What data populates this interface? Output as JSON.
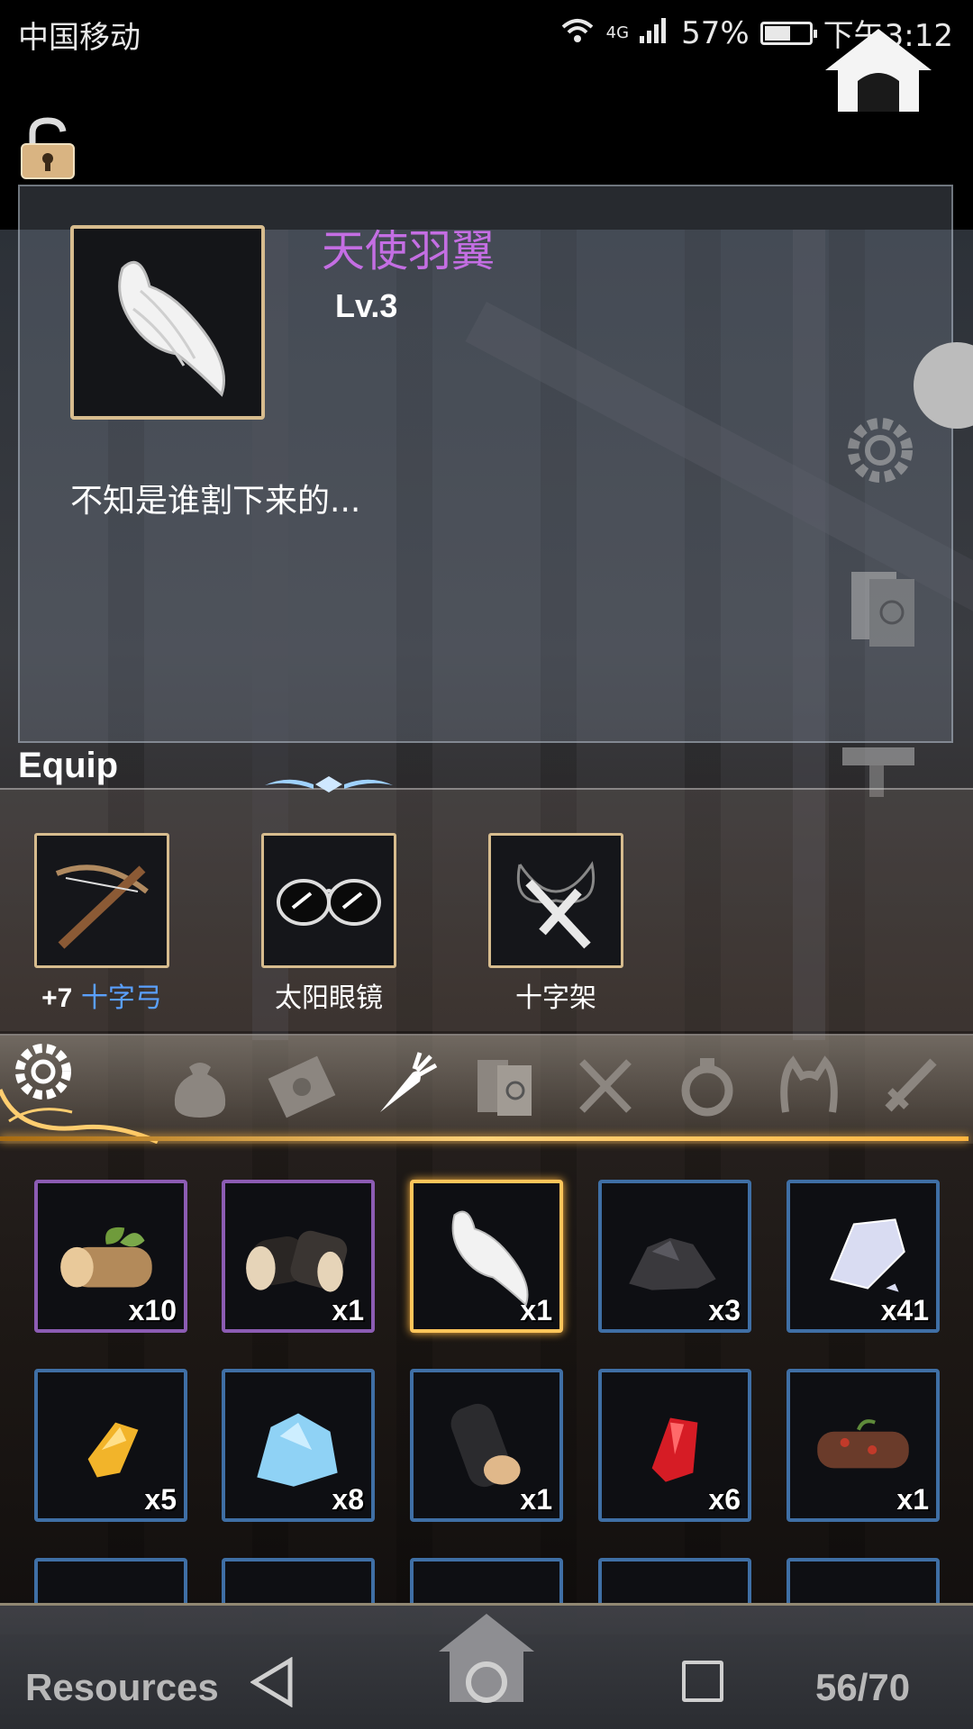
{
  "status_bar": {
    "carrier": "中国移动",
    "network": "4G",
    "battery": "57%",
    "time": "下午3:12"
  },
  "detail": {
    "name": "天使羽翼",
    "level": "Lv.3",
    "description": "不知是谁割下来的..."
  },
  "equip": {
    "title": "Equip",
    "slots": [
      {
        "plus": "+7",
        "name": "十字弓",
        "icon": "crossbow-icon"
      },
      {
        "plus": "",
        "name": "太阳眼镜",
        "icon": "sunglasses-icon"
      },
      {
        "plus": "",
        "name": "十字架",
        "icon": "cross-necklace-icon"
      }
    ]
  },
  "categories": [
    "bag-icon",
    "envelope-icon",
    "carrot-icon",
    "books-icon",
    "utensils-icon",
    "ring-icon",
    "headband-icon",
    "sword-icon"
  ],
  "inventory": [
    {
      "icon": "leafy-log-icon",
      "count": "x10",
      "rarity": "purple"
    },
    {
      "icon": "dark-logs-icon",
      "count": "x1",
      "rarity": "purple"
    },
    {
      "icon": "angel-wing-icon",
      "count": "x1",
      "rarity": "gold"
    },
    {
      "icon": "coal-icon",
      "count": "x3",
      "rarity": "blue"
    },
    {
      "icon": "crystal-plate-icon",
      "count": "x41",
      "rarity": "blue"
    },
    {
      "icon": "amber-gem-icon",
      "count": "x5",
      "rarity": "blue"
    },
    {
      "icon": "ice-crystal-icon",
      "count": "x8",
      "rarity": "blue"
    },
    {
      "icon": "charred-log-icon",
      "count": "x1",
      "rarity": "blue"
    },
    {
      "icon": "red-gem-icon",
      "count": "x6",
      "rarity": "blue"
    },
    {
      "icon": "rotten-log-icon",
      "count": "x1",
      "rarity": "blue"
    }
  ],
  "bottom": {
    "label": "Resources",
    "count": "56/70"
  },
  "colors": {
    "name_purple": "#c46ee3",
    "frame_gold": "#d7bc8e",
    "slot_blue": "#3f6fa5",
    "slot_purple": "#8c5cb3",
    "selected_gold": "#ffc55a"
  }
}
